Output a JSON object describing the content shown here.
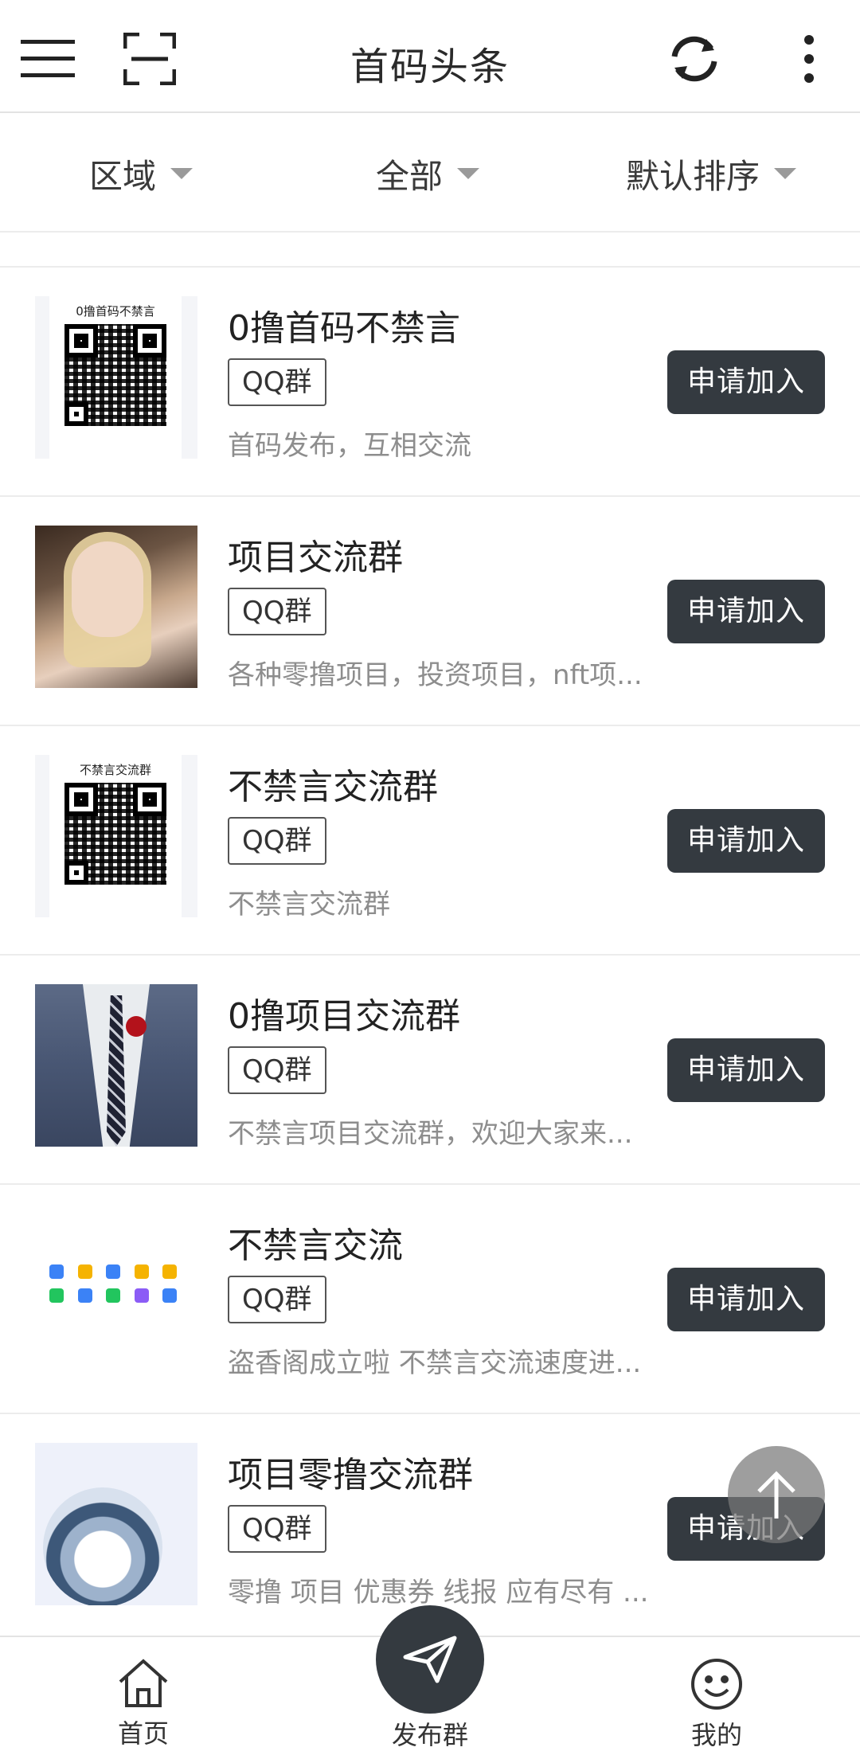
{
  "header": {
    "title": "首码头条",
    "icons": [
      "menu-icon",
      "scan-icon",
      "refresh-icon",
      "more-vertical-icon"
    ]
  },
  "filters": [
    {
      "label": "区域"
    },
    {
      "label": "全部"
    },
    {
      "label": "默认排序"
    }
  ],
  "groups": [
    {
      "title": "0撸首码不禁言",
      "badge": "QQ群",
      "desc": "首码发布，互相交流",
      "button": "申请加入",
      "qr_title": "0撸首码不禁言"
    },
    {
      "title": "项目交流群",
      "badge": "QQ群",
      "desc": "各种零撸项目，投资项目，nft项...",
      "button": "申请加入"
    },
    {
      "title": "不禁言交流群",
      "badge": "QQ群",
      "desc": "不禁言交流群",
      "button": "申请加入",
      "qr_title": "不禁言交流群"
    },
    {
      "title": "0撸项目交流群",
      "badge": "QQ群",
      "desc": "不禁言项目交流群，欢迎大家来...",
      "button": "申请加入"
    },
    {
      "title": "不禁言交流",
      "badge": "QQ群",
      "desc": "盗香阁成立啦 不禁言交流速度进...",
      "button": "申请加入"
    },
    {
      "title": "项目零撸交流群",
      "badge": "QQ群",
      "desc": "零撸 项目 优惠券 线报 应有尽有 ...",
      "button": "申请加入"
    }
  ],
  "bottom_nav": {
    "home": "首页",
    "publish": "发布群",
    "me": "我的"
  },
  "colors": {
    "accent_dark": "#343a40",
    "desc_gray": "#8d8d8d"
  }
}
